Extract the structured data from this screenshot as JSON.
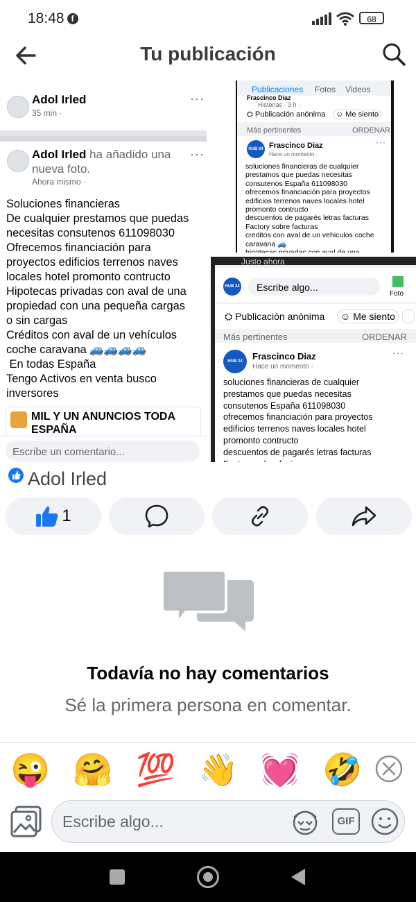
{
  "status_bar": {
    "time": "18:48",
    "app_glyph": "f",
    "battery": "68"
  },
  "header": {
    "title": "Tu publicación"
  },
  "shot_a": {
    "top_post_name": "Adol Irled",
    "top_post_time": "35 min ·",
    "author": "Adol Irled",
    "action": "ha añadido una nueva foto.",
    "time": "Ahora mismo ·",
    "body": [
      "Soluciones financieras",
      "De cualquier prestamos que puedas",
      "necesitas consutenos 611098030",
      "Ofrecemos financiación para",
      "proyectos edificios terrenos naves",
      "locales hotel promonto contructo",
      "Hipotecas privadas con aval de una",
      "propiedad con una pequeña cargas",
      "o sin cargas",
      "Créditos con aval de un vehículos",
      "coche caravana 🚙🚙🚙🚙",
      " En todas España",
      "Tengo Activos en venta busco",
      "inversores"
    ],
    "page_name": "MIL Y UN ANUNCIOS TODA ESPAÑA",
    "comment_placeholder": "Escribe un comentario..."
  },
  "shot_b": {
    "tabs": [
      "Publicaciones",
      "Fotos",
      "Videos"
    ],
    "partial_name": "Frascinco Diaz",
    "history": "Historias · 3 h · ",
    "anon": "Publicación anónima",
    "feeling": "Me siento",
    "relevant": "Más pertinentes",
    "order": "ORDENAR",
    "name": "Frascinco Diaz",
    "time": "Hace un momento · ",
    "avatar_text": "HUB 24",
    "body": [
      "soluciones financieras de cualquier",
      "prestamos que puedas necesitas",
      "consutenos España 611098030",
      "ofrecemos financiación para proyectos",
      "edificios terrenos naves locales hotel",
      "promonto contructo",
      "descuentos de pagarés letras facturas",
      "Factory sobre facturas",
      "creditos con aval de un vehiculos coche",
      "caravana 🚙",
      "hipotecas privadas con aval de una"
    ]
  },
  "shot_c": {
    "top": "Justo ahora",
    "input": "Escribe algo...",
    "photo": "Foto",
    "anon": "Publicación anónima",
    "feeling": "Me siento",
    "relevant": "Más pertinentes",
    "order": "ORDENAR",
    "name": "Frascinco Diaz",
    "time": "Hace un momento · ",
    "avatar_text": "HUB 24",
    "body": [
      "soluciones financieras de cualquier",
      "prestamos que puedas necesitas",
      "consutenos España 611098030",
      "ofrecemos financiación para proyectos",
      "edificios terrenos naves locales hotel",
      "promonto contructo",
      "descuentos de pagarés letras facturas",
      "Factory sobre facturas"
    ]
  },
  "author_line": {
    "name": "Adol Irled"
  },
  "actions": {
    "like_count": "1"
  },
  "empty_state": {
    "title": "Todavía no hay comentarios",
    "subtitle": "Sé la primera persona en comentar."
  },
  "emoji_bar": [
    "😜",
    "🤗",
    "💯",
    "👋",
    "💓",
    "🤣"
  ],
  "composer": {
    "placeholder": "Escribe algo...",
    "gif_label": "GIF"
  },
  "colors": {
    "accent": "#1877f2",
    "text": "#050505",
    "muted": "#65676b",
    "pill": "#f0f2f5"
  }
}
